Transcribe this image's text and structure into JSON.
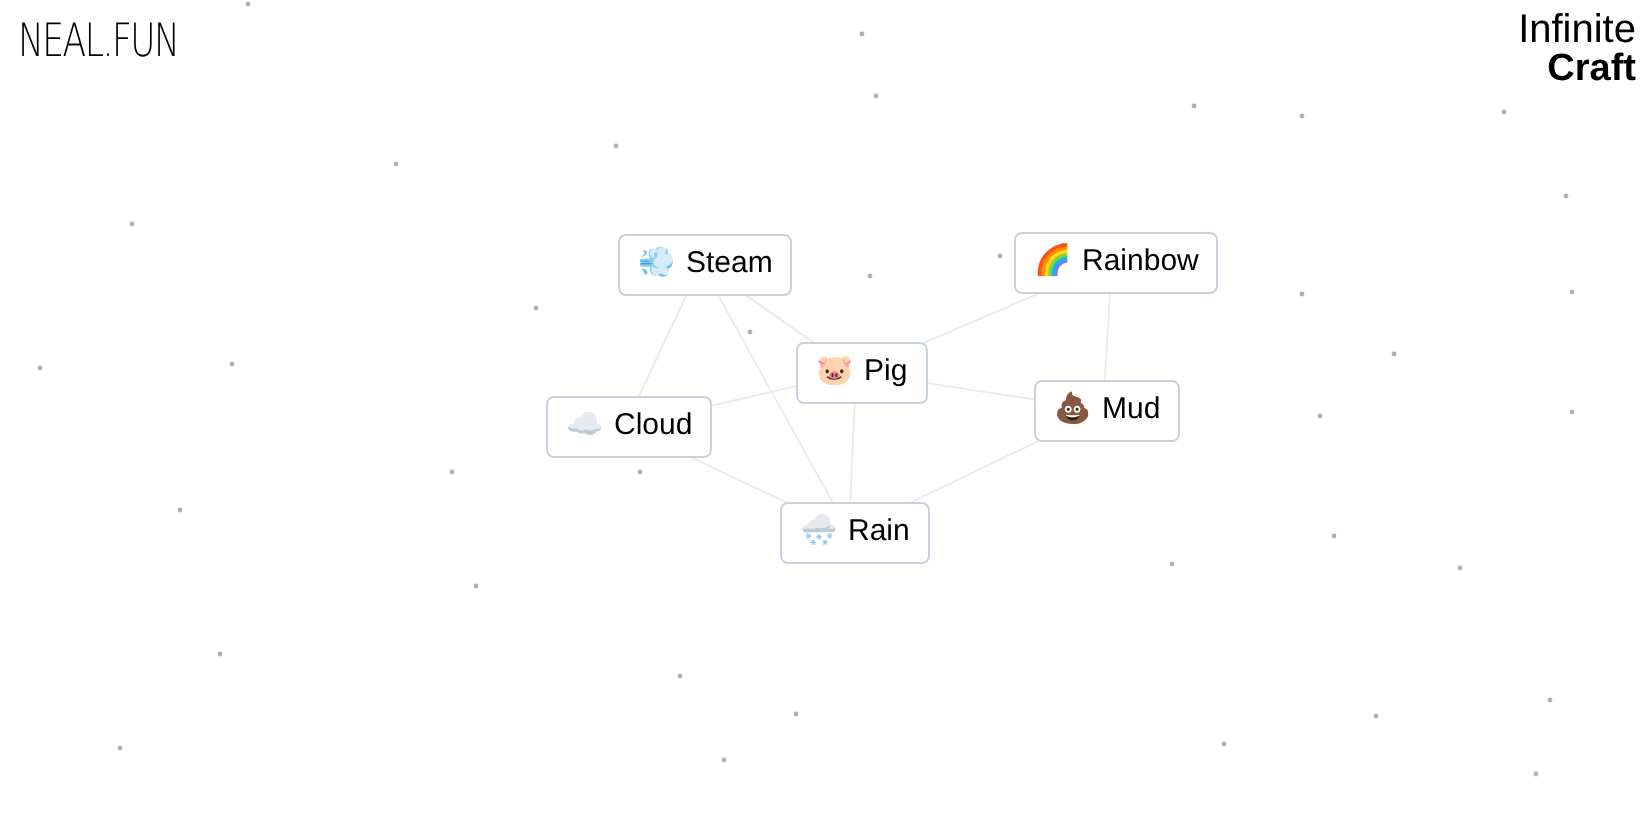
{
  "logo": "NEAL.FUN",
  "title": {
    "line_1": "Infinite",
    "line_2": "Craft"
  },
  "elements": [
    {
      "emoji": "💨",
      "label": "Steam"
    },
    {
      "emoji": "🌈",
      "label": "Rainbow"
    },
    {
      "emoji": "🐷",
      "label": "Pig"
    },
    {
      "emoji": "☁️",
      "label": "Cloud"
    },
    {
      "emoji": "💩",
      "label": "Mud"
    },
    {
      "emoji": "🌨️",
      "label": "Rain"
    }
  ]
}
